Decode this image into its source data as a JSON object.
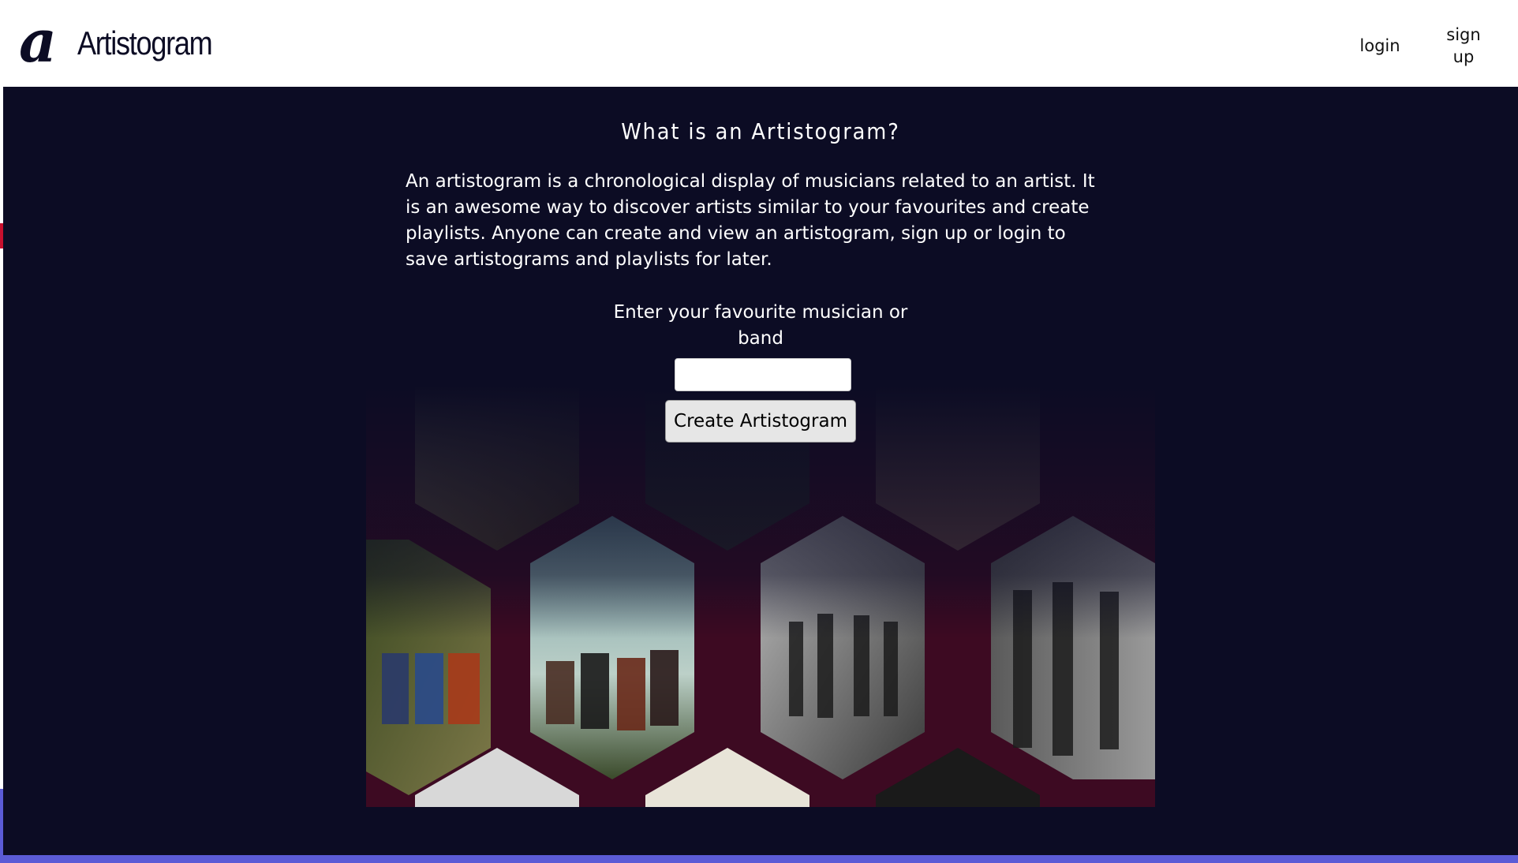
{
  "header": {
    "logo_text": "Artistogram",
    "logo_mark": "a",
    "nav": {
      "login_label": "login",
      "signup_label": "sign up"
    }
  },
  "main": {
    "title": "What is an Artistogram?",
    "description": "An artistogram is a chronological display of musicians related to an artist. It is an awesome way to discover artists similar to your favourites and create playlists. Anyone can create and view an artistogram, sign up or login to save artistograms and playlists for later.",
    "prompt": "Enter your favourite musician or band",
    "input_value": "",
    "create_button_label": "Create Artistogram"
  },
  "colors": {
    "background_dark": "#0c0c24",
    "accent": "#5b5bd6",
    "hex_border": "#3d0a22"
  }
}
